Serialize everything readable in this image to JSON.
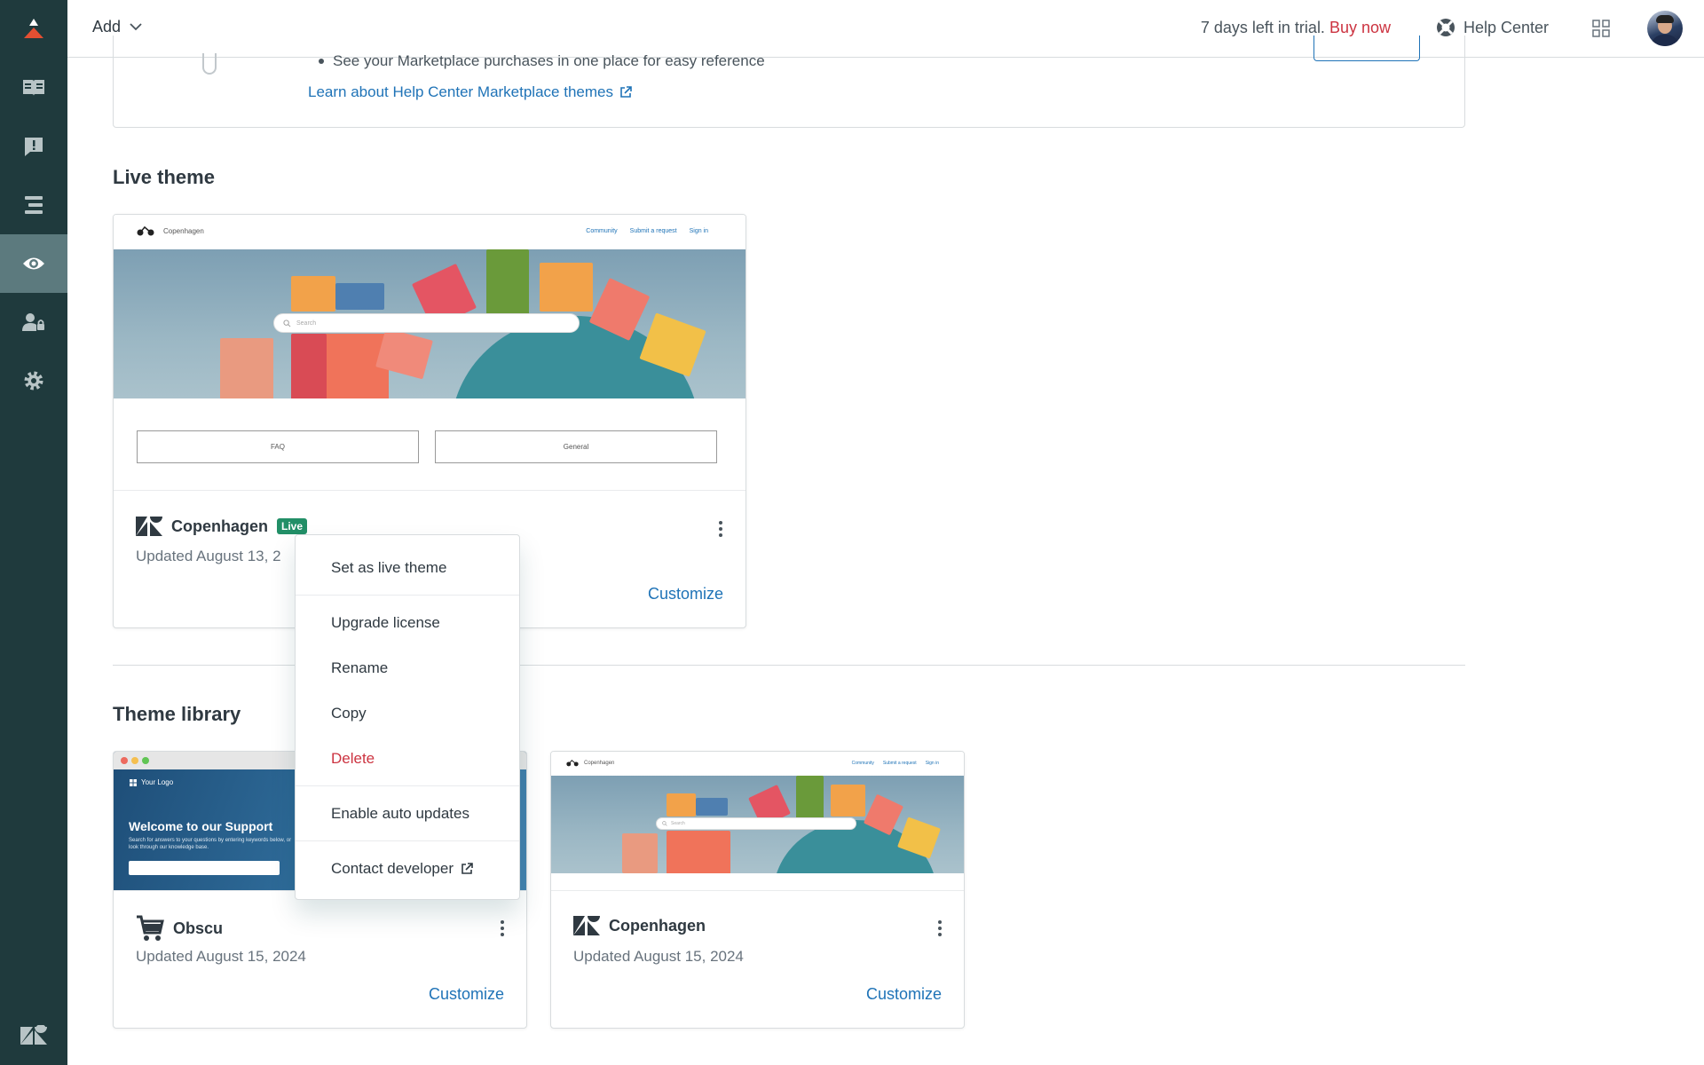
{
  "topbar": {
    "add_label": "Add",
    "trial_text": "7 days left in trial.",
    "buy_now": "Buy now",
    "help_center": "Help Center"
  },
  "sidebar": {
    "items": [
      {
        "name": "guides",
        "icon": "book-icon"
      },
      {
        "name": "alerts",
        "icon": "alert-icon"
      },
      {
        "name": "arrange",
        "icon": "bars-icon"
      },
      {
        "name": "customize-design",
        "icon": "eye-icon",
        "active": true
      },
      {
        "name": "user-permissions",
        "icon": "user-lock-icon"
      },
      {
        "name": "settings",
        "icon": "gear-icon"
      }
    ]
  },
  "marketplace": {
    "bullet": "See your Marketplace purchases in one place for easy reference",
    "link": "Learn about Help Center Marketplace themes"
  },
  "live_theme": {
    "section_title": "Live theme",
    "preview": {
      "brand": "Copenhagen",
      "nav_links": [
        "Community",
        "Submit a request",
        "Sign in"
      ],
      "search_placeholder": "Search",
      "buttons": [
        "FAQ",
        "General"
      ]
    },
    "name": "Copenhagen",
    "badge": "Live",
    "updated": "Updated August 13, 2",
    "customize": "Customize"
  },
  "theme_library": {
    "section_title": "Theme library",
    "themes": [
      {
        "name": "Obscu",
        "updated": "Updated August 15, 2024",
        "customize": "Customize",
        "preview": {
          "logo": "Your Logo",
          "headline": "Welcome to our Support",
          "subtext": "Search for answers to your questions by entering keywords below, or look through our knowledge base."
        }
      },
      {
        "name": "Copenhagen",
        "updated": "Updated August 15, 2024",
        "customize": "Customize",
        "preview": {
          "brand": "Copenhagen",
          "nav_links": [
            "Community",
            "Submit a request",
            "Sign in"
          ],
          "search_placeholder": "Search"
        }
      }
    ]
  },
  "context_menu": {
    "items": [
      {
        "label": "Set as live theme"
      },
      {
        "label": "Upgrade license"
      },
      {
        "label": "Rename"
      },
      {
        "label": "Copy"
      },
      {
        "label": "Delete",
        "danger": true
      },
      {
        "label": "Enable auto updates"
      },
      {
        "label": "Contact developer",
        "external": true
      }
    ]
  },
  "colors": {
    "sidebar": "#1f3a3d",
    "sidebar_active": "#5c7a7e",
    "link": "#1f73b7",
    "danger": "#cc3340",
    "live_badge": "#228f67"
  }
}
